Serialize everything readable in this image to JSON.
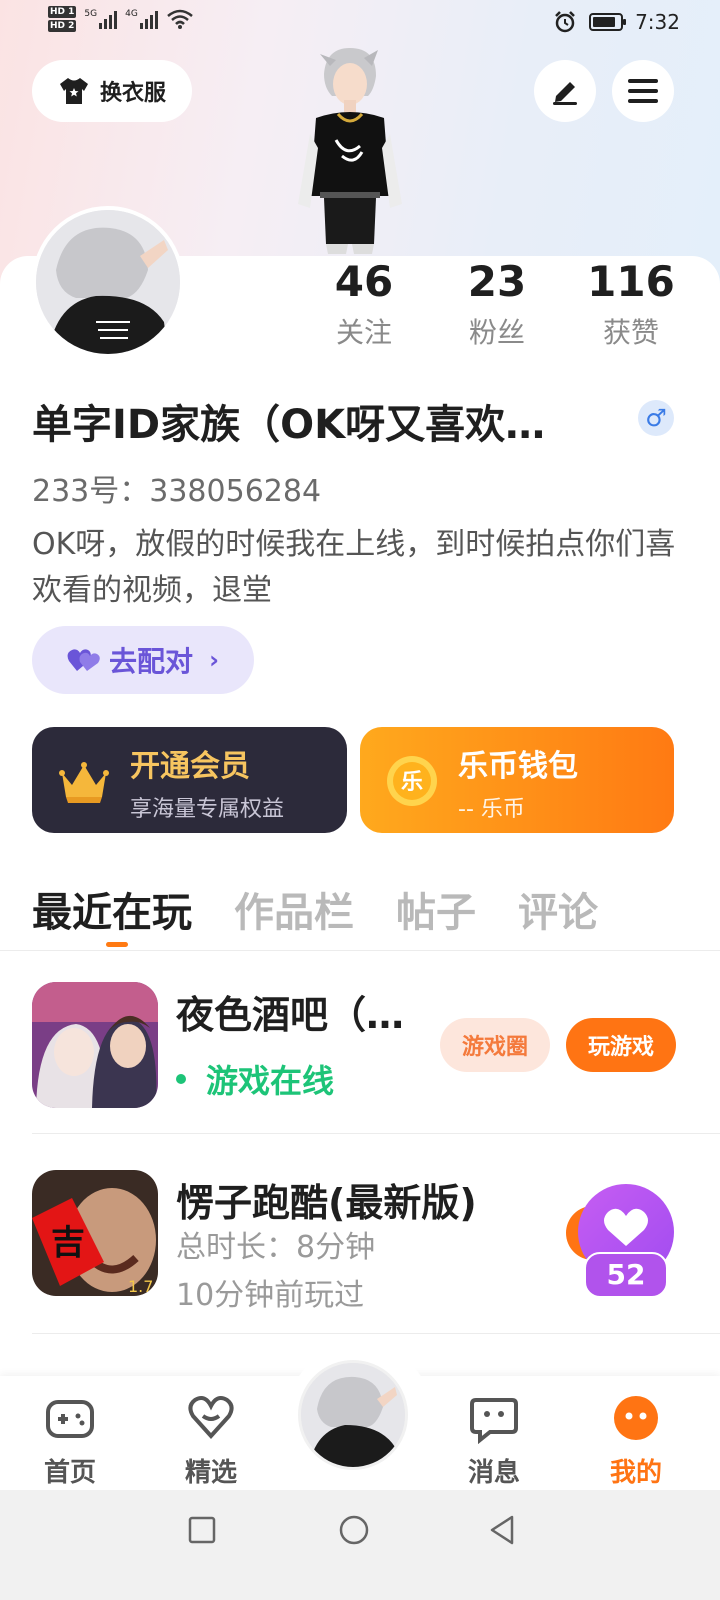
{
  "status_bar": {
    "hd1": "HD 1",
    "hd2": "HD 2",
    "net1": "5G",
    "net2": "4G",
    "time": "7:32",
    "icons": [
      "wifi-icon",
      "alarm-icon",
      "battery-icon"
    ]
  },
  "header": {
    "outfit_label": "换衣服",
    "icons": [
      "shirt-icon",
      "edit-icon",
      "menu-icon"
    ]
  },
  "stats": [
    {
      "value": "46",
      "label": "关注"
    },
    {
      "value": "23",
      "label": "粉丝"
    },
    {
      "value": "116",
      "label": "获赞"
    }
  ],
  "profile": {
    "name": "单字ID家族（OK呀又喜欢…",
    "gender_symbol": "♂",
    "uid": "233号：338056284",
    "bio": "OK呀，放假的时候我在上线，到时候拍点你们喜欢看的视频，退堂",
    "match_label": "去配对",
    "match_chevron": "›"
  },
  "vip": {
    "title": "开通会员",
    "subtitle": "享海量专属权益",
    "icon": "crown-icon"
  },
  "wallet": {
    "title": "乐币钱包",
    "subtitle": "-- 乐币",
    "coin_glyph": "乐",
    "icon": "coin-icon"
  },
  "tabs": [
    {
      "label": "最近在玩",
      "active": true
    },
    {
      "label": "作品栏",
      "active": false
    },
    {
      "label": "帖子",
      "active": false
    },
    {
      "label": "评论",
      "active": false
    }
  ],
  "games": [
    {
      "title": "夜色酒吧（…",
      "status": "游戏在线",
      "circle_label": "游戏圈",
      "play_label": "玩游戏"
    },
    {
      "title": "愣子跑酷(最新版)",
      "duration": "总时长：8分钟",
      "last_played": "10分钟前玩过",
      "icon_glyph": "吉",
      "icon_corner": "1.7"
    }
  ],
  "like_badge": {
    "count": "52",
    "icon": "heart-icon"
  },
  "bottom_nav": [
    {
      "label": "首页",
      "icon": "gamepad-icon",
      "active": false
    },
    {
      "label": "精选",
      "icon": "heart-outline-icon",
      "active": false
    },
    {
      "label": "消息",
      "icon": "chat-icon",
      "active": false
    },
    {
      "label": "我的",
      "icon": "face-icon",
      "active": true
    }
  ],
  "colors": {
    "accent": "#ff7413",
    "online": "#1dc478",
    "match": "#6a55d8",
    "vip_dark": "#2c2a3a"
  }
}
